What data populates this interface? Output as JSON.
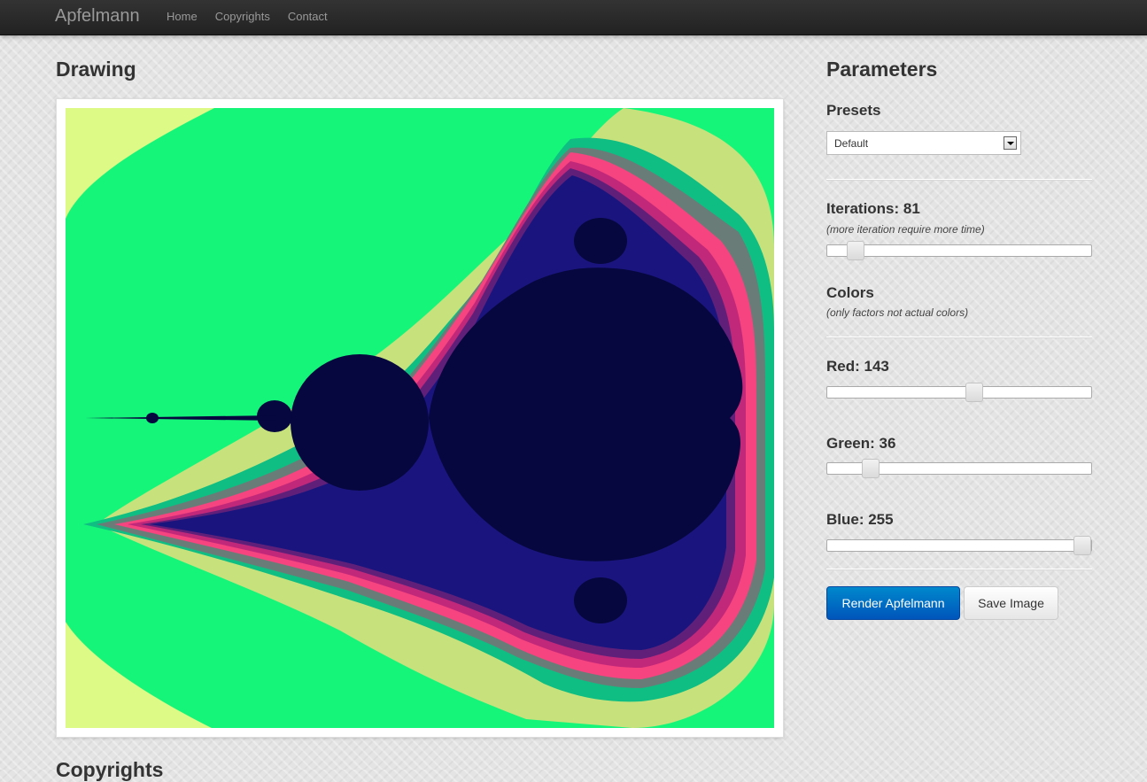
{
  "navbar": {
    "brand": "Apfelmann",
    "links": [
      "Home",
      "Copyrights",
      "Contact"
    ]
  },
  "drawing": {
    "heading": "Drawing",
    "image_icon": "mandelbrot-fractal-image",
    "palette": {
      "interior": "#06073f",
      "outer": "#15f57a",
      "band1": "#dcfa85",
      "band2": "#c7e27c",
      "band3": "#0fbe82",
      "band4": "#6a7c78",
      "band5": "#f5447f",
      "band6": "#c2287a",
      "band7": "#60207a",
      "band8": "#1a157e"
    }
  },
  "parameters": {
    "heading": "Parameters",
    "presets_label": "Presets",
    "preset_value": "Default",
    "iterations_label": "Iterations: 81",
    "iterations_hint": "(more iteration require more time)",
    "iterations_level": 0.08,
    "colors_label": "Colors",
    "colors_hint": "(only factors not actual colors)",
    "red_label": "Red: 143",
    "red_level": 0.56,
    "green_label": "Green: 36",
    "green_level": 0.14,
    "blue_label": "Blue: 255",
    "blue_level": 1.0,
    "render_button": "Render Apfelmann",
    "save_button": "Save Image"
  },
  "footer": {
    "heading": "Copyrights"
  }
}
